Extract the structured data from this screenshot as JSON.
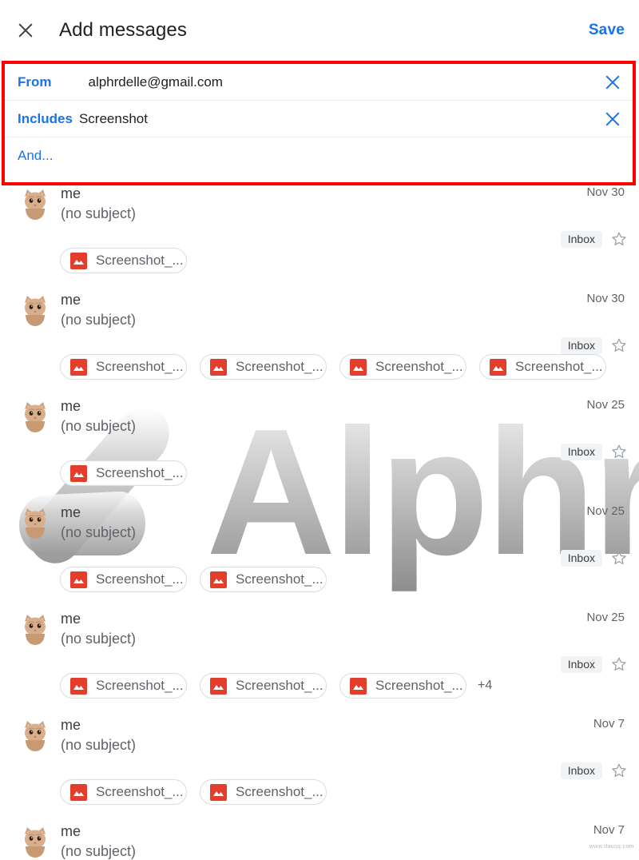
{
  "header": {
    "close_icon": "close-icon",
    "title": "Add messages",
    "save_label": "Save"
  },
  "filter_card": {
    "border_color": "#ff0000",
    "rows": [
      {
        "key": "From",
        "value": "alphrdelle@gmail.com",
        "remove_icon": "close-icon"
      },
      {
        "key": "Includes",
        "value": "Screenshot",
        "remove_icon": "close-icon"
      }
    ],
    "add_condition_label": "And..."
  },
  "watermark": {
    "text": "Alphr",
    "footer_text": "www.dausq.com"
  },
  "messages": [
    {
      "sender": "me",
      "subject": "(no subject)",
      "date": "Nov 30",
      "label": "Inbox",
      "star_icon": "star-outline-icon",
      "avatar_icon": "cat-avatar",
      "attachments": [
        "Screenshot_..."
      ],
      "more_count": ""
    },
    {
      "sender": "me",
      "subject": "(no subject)",
      "date": "Nov 30",
      "label": "Inbox",
      "star_icon": "star-outline-icon",
      "avatar_icon": "cat-avatar",
      "attachments": [
        "Screenshot_...",
        "Screenshot_...",
        "Screenshot_...",
        "Screenshot_..."
      ],
      "more_count": ""
    },
    {
      "sender": "me",
      "subject": "(no subject)",
      "date": "Nov 25",
      "label": "Inbox",
      "star_icon": "star-outline-icon",
      "avatar_icon": "cat-avatar",
      "attachments": [
        "Screenshot_..."
      ],
      "more_count": ""
    },
    {
      "sender": "me",
      "subject": "(no subject)",
      "date": "Nov 25",
      "label": "Inbox",
      "star_icon": "star-outline-icon",
      "avatar_icon": "cat-avatar",
      "attachments": [
        "Screenshot_...",
        "Screenshot_..."
      ],
      "more_count": ""
    },
    {
      "sender": "me",
      "subject": "(no subject)",
      "date": "Nov 25",
      "label": "Inbox",
      "star_icon": "star-outline-icon",
      "avatar_icon": "cat-avatar",
      "attachments": [
        "Screenshot_...",
        "Screenshot_...",
        "Screenshot_..."
      ],
      "more_count": "+4"
    },
    {
      "sender": "me",
      "subject": "(no subject)",
      "date": "Nov 7",
      "label": "Inbox",
      "star_icon": "star-outline-icon",
      "avatar_icon": "cat-avatar",
      "attachments": [
        "Screenshot_...",
        "Screenshot_..."
      ],
      "more_count": ""
    },
    {
      "sender": "me",
      "subject": "(no subject)",
      "date": "Nov 7",
      "label": "",
      "star_icon": "",
      "avatar_icon": "cat-avatar",
      "attachments": [],
      "more_count": ""
    }
  ],
  "colors": {
    "accent_blue": "#1a73e8",
    "highlight_red": "#ff0000",
    "chip_icon_red": "#e33e2b",
    "badge_bg": "#f1f3f4"
  }
}
